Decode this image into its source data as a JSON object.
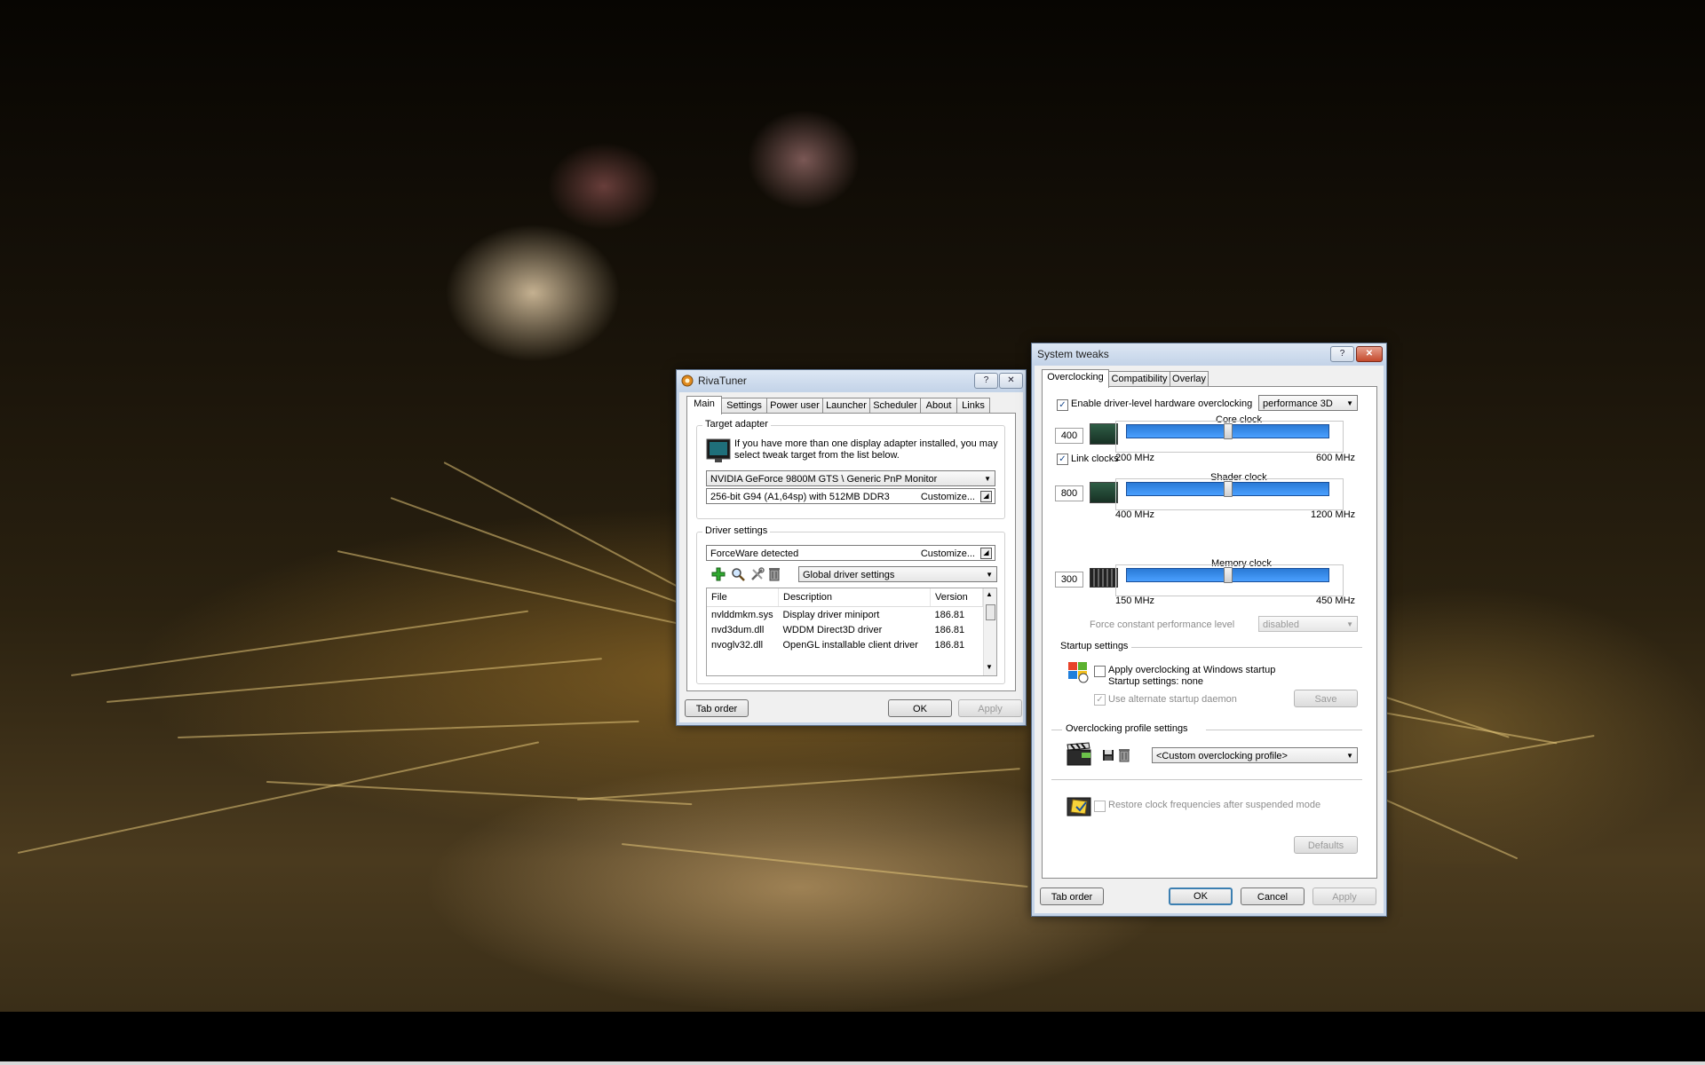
{
  "rivatuner": {
    "title": "RivaTuner",
    "help_label": "?",
    "close_label": "✕",
    "tabs": [
      {
        "label": "Main"
      },
      {
        "label": "Settings"
      },
      {
        "label": "Power user"
      },
      {
        "label": "Launcher"
      },
      {
        "label": "Scheduler"
      },
      {
        "label": "About"
      },
      {
        "label": "Links"
      }
    ],
    "target_adapter": {
      "label": "Target adapter",
      "info_line1": "If you have more than one display adapter installed, you may",
      "info_line2": "select tweak target from the list below.",
      "adapter_select": "NVIDIA GeForce 9800M GTS  \\ Generic PnP Monitor",
      "adapter_info": "256-bit G94 (A1,64sp) with 512MB DDR3",
      "customize_label": "Customize..."
    },
    "driver_settings": {
      "label": "Driver settings",
      "driver_detected": "ForceWare detected",
      "customize_label": "Customize...",
      "settings_select": "Global driver settings",
      "columns": [
        "File",
        "Description",
        "Version"
      ],
      "rows": [
        {
          "file": "nvlddmkm.sys",
          "description": "Display driver miniport",
          "version": "186.81"
        },
        {
          "file": "nvd3dum.dll",
          "description": "WDDM Direct3D driver",
          "version": "186.81"
        },
        {
          "file": "nvoglv32.dll",
          "description": "OpenGL installable client driver",
          "version": "186.81"
        }
      ]
    },
    "buttons": {
      "tab_order": "Tab order",
      "ok": "OK",
      "apply": "Apply"
    }
  },
  "system_tweaks": {
    "title": "System tweaks",
    "help_label": "?",
    "close_label": "✕",
    "tabs": [
      {
        "label": "Overclocking"
      },
      {
        "label": "Compatibility"
      },
      {
        "label": "Overlay"
      }
    ],
    "enable_oc_label": "Enable driver-level hardware overclocking",
    "enable_oc_checked": true,
    "mode_select": "performance 3D",
    "link_clocks_label": "Link clocks",
    "link_clocks_checked": true,
    "core": {
      "label": "Core clock",
      "value": "400",
      "min": "200 MHz",
      "max": "600 MHz",
      "min_value": 200,
      "max_value": 600,
      "current": 400
    },
    "shader": {
      "label": "Shader clock",
      "value": "800",
      "min": "400 MHz",
      "max": "1200 MHz",
      "min_value": 400,
      "max_value": 1200,
      "current": 800
    },
    "memory": {
      "label": "Memory clock",
      "value": "300",
      "min": "150 MHz",
      "max": "450 MHz",
      "min_value": 150,
      "max_value": 450,
      "current": 300
    },
    "force_perf_label": "Force constant performance level",
    "force_perf_select": "disabled",
    "startup": {
      "label": "Startup settings",
      "apply_label": "Apply overclocking at Windows startup",
      "status": "Startup settings: none",
      "alt_daemon_label": "Use alternate startup daemon",
      "save_label": "Save"
    },
    "profile": {
      "label": "Overclocking profile settings",
      "select": "<Custom overclocking profile>"
    },
    "restore_label": "Restore clock frequencies after suspended mode",
    "defaults_label": "Defaults",
    "buttons": {
      "tab_order": "Tab order",
      "ok": "OK",
      "cancel": "Cancel",
      "apply": "Apply"
    },
    "check_mark": "✓"
  },
  "colors": {
    "slider_fill": "#2a7ad6",
    "titlebar": "#c3d3e8"
  }
}
